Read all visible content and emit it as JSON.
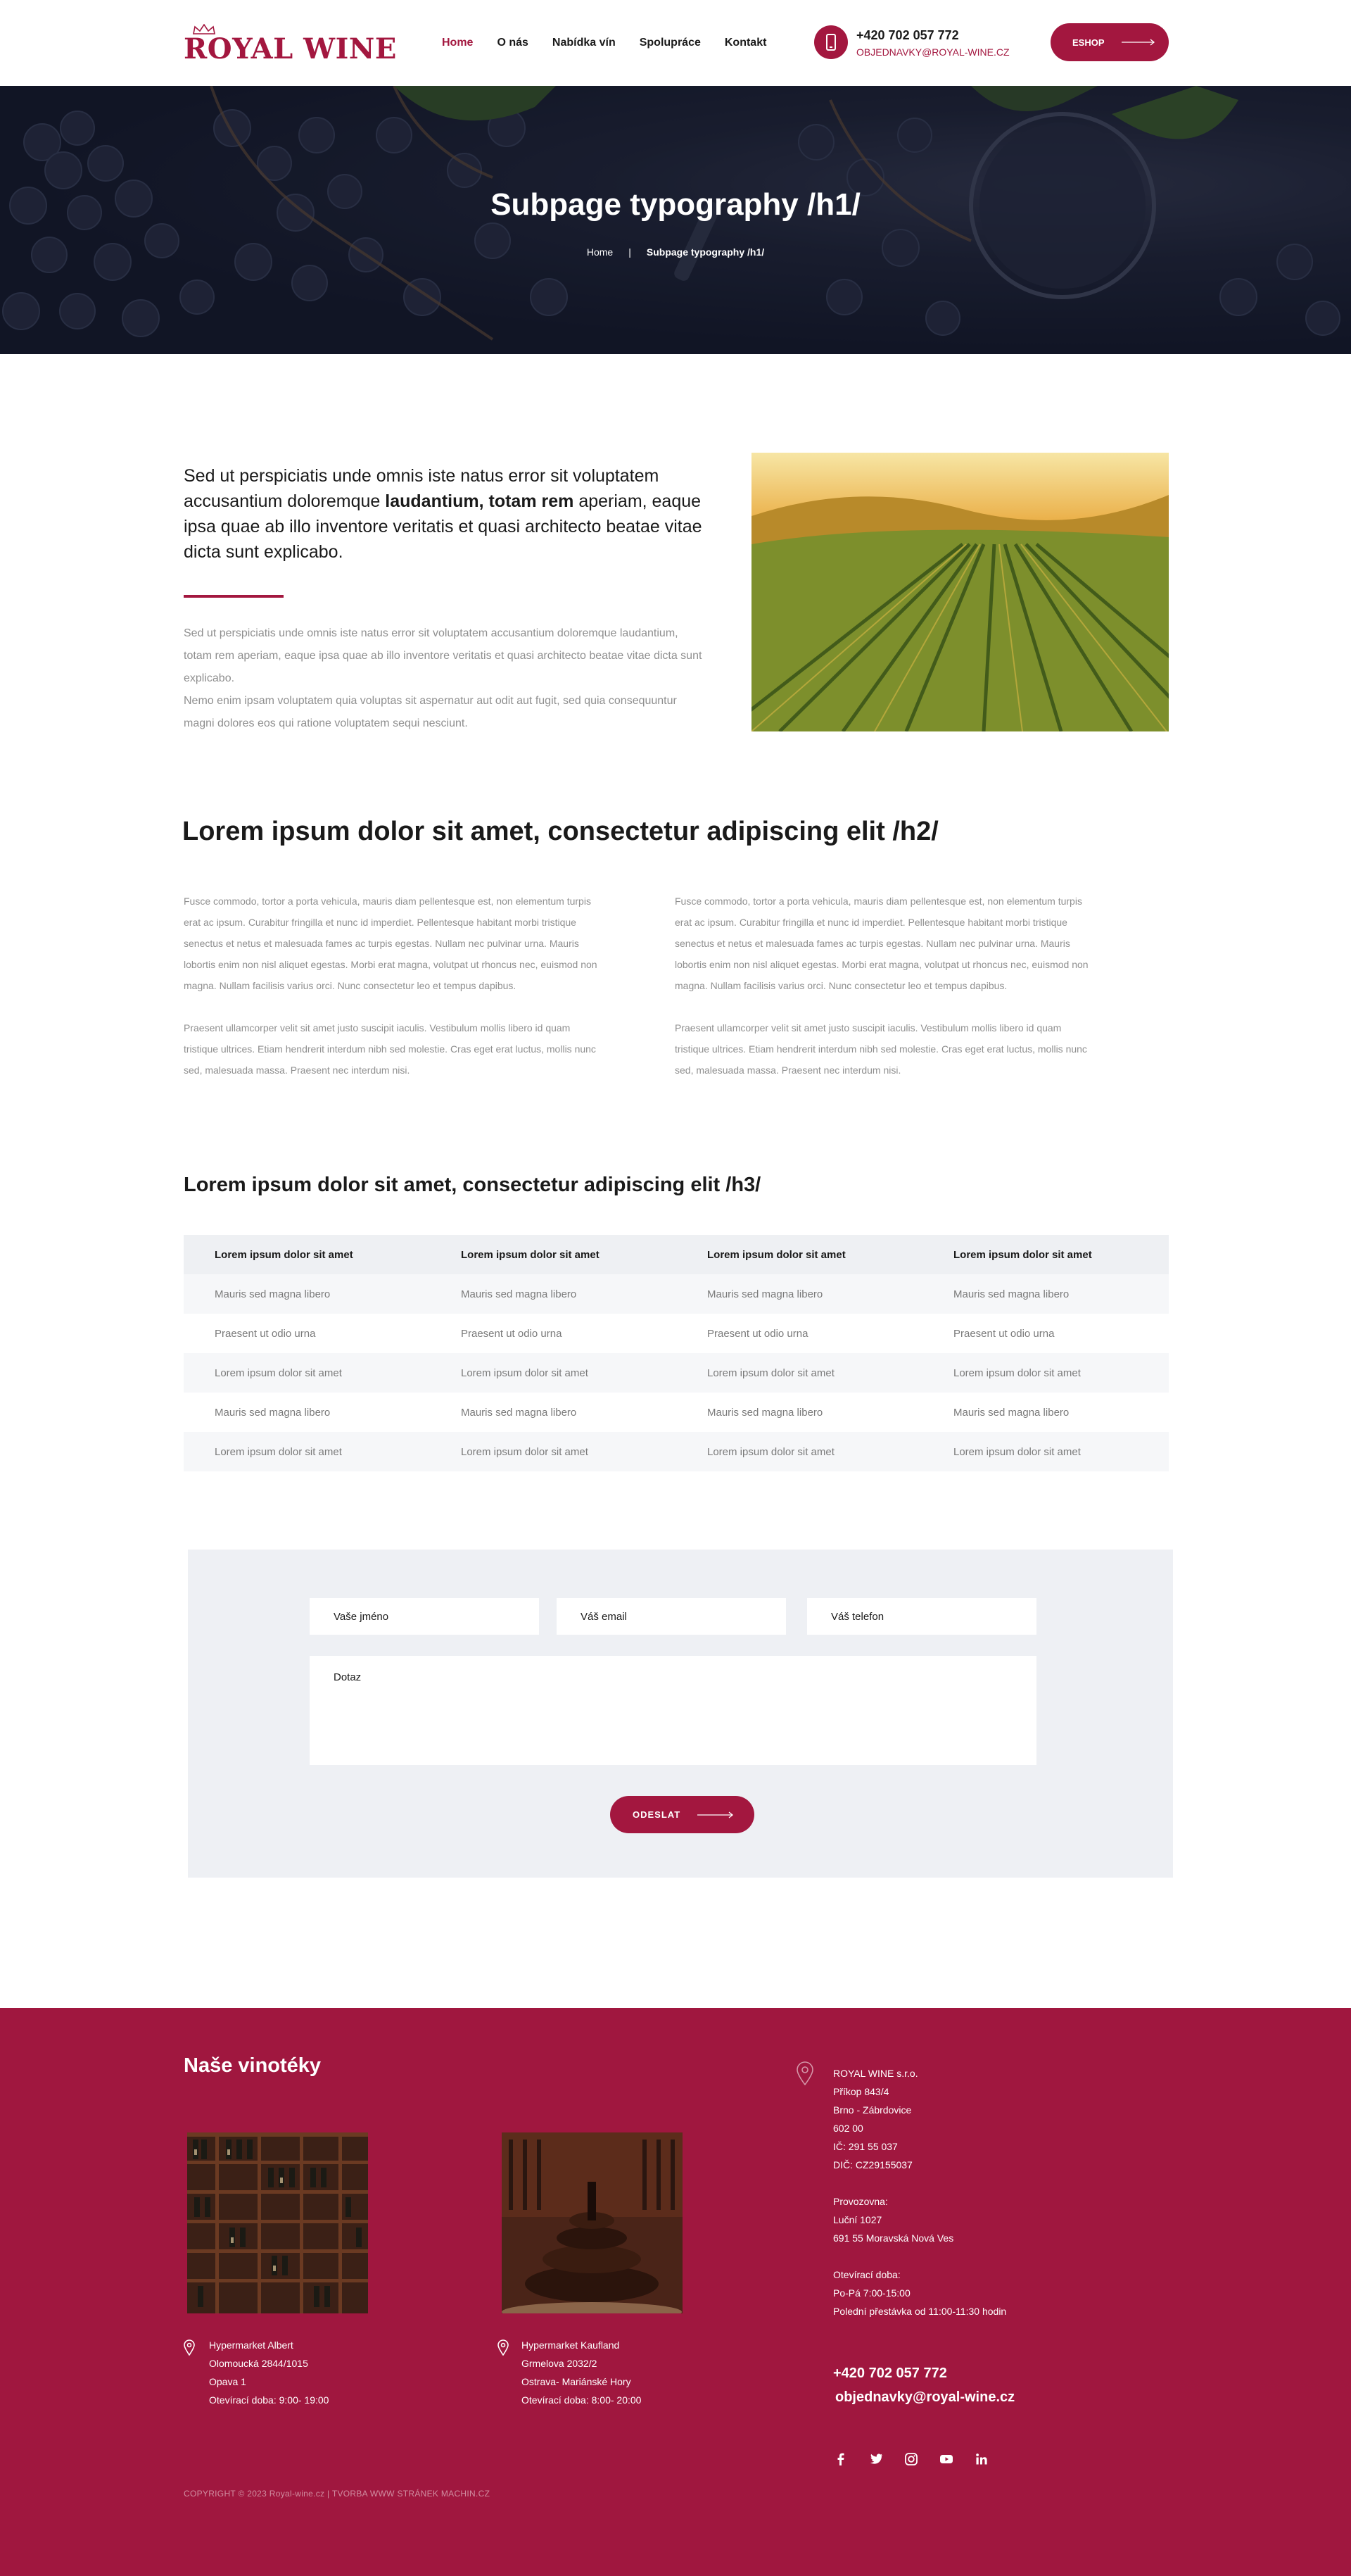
{
  "header": {
    "logo_text": "ROYAL WINE",
    "nav": [
      "Home",
      "O nás",
      "Nabídka vín",
      "Spolupráce",
      "Kontakt"
    ],
    "phone": "+420 702 057 772",
    "email": "OBJEDNAVKY@ROYAL-WINE.CZ",
    "eshop_label": "ESHOP"
  },
  "hero": {
    "title": "Subpage typography /h1/",
    "breadcrumb_home": "Home",
    "breadcrumb_current": "Subpage typography /h1/"
  },
  "intro": {
    "lead_1": "Sed ut perspiciatis unde omnis iste natus error sit voluptatem accusantium doloremque ",
    "lead_bold": "laudantium, totam rem",
    "lead_2": " aperiam, eaque ipsa quae ab illo inventore veritatis et quasi architecto beatae vitae dicta sunt explicabo.",
    "paragraph": "Sed ut perspiciatis unde omnis iste natus error sit voluptatem accusantium doloremque laudantium, totam rem aperiam, eaque ipsa quae ab illo inventore veritatis et quasi architecto beatae vitae dicta sunt explicabo.",
    "paragraph_2": "Nemo enim ipsam voluptatem quia voluptas sit aspernatur aut odit aut fugit, sed quia consequuntur magni dolores eos qui ratione voluptatem sequi nesciunt."
  },
  "section_h2": {
    "title": "Lorem ipsum dolor sit amet, consectetur adipiscing elit /h2/",
    "p1": "Fusce commodo, tortor a porta vehicula, mauris diam pellentesque est, non elementum turpis erat ac ipsum. Curabitur fringilla et nunc id imperdiet. Pellentesque habitant morbi tristique senectus et netus et malesuada fames ac turpis egestas. Nullam nec pulvinar urna. Mauris lobortis enim non nisl aliquet egestas. Morbi erat magna, volutpat ut rhoncus nec, euismod non magna. Nullam facilisis varius orci. Nunc consectetur leo et tempus dapibus.",
    "p2": "Praesent ullamcorper velit sit amet justo suscipit iaculis. Vestibulum mollis libero id quam tristique ultrices. Etiam hendrerit interdum nibh sed molestie. Cras eget erat luctus, mollis nunc sed, malesuada massa. Praesent nec interdum nisi."
  },
  "section_h3": {
    "title": "Lorem ipsum dolor sit amet, consectetur adipiscing elit /h3/"
  },
  "table": {
    "headers": [
      "Lorem ipsum dolor sit amet",
      "Lorem ipsum dolor sit amet",
      "Lorem ipsum dolor sit amet",
      "Lorem ipsum dolor sit amet"
    ],
    "rows": [
      [
        "Mauris sed magna libero",
        "Mauris sed magna libero",
        "Mauris sed magna libero",
        "Mauris sed magna libero"
      ],
      [
        "Praesent ut odio urna",
        "Praesent ut odio urna",
        "Praesent ut odio urna",
        "Praesent ut odio urna"
      ],
      [
        "Lorem ipsum dolor sit amet",
        "Lorem ipsum dolor sit amet",
        "Lorem ipsum dolor sit amet",
        "Lorem ipsum dolor sit amet"
      ],
      [
        "Mauris sed magna libero",
        "Mauris sed magna libero",
        "Mauris sed magna libero",
        "Mauris sed magna libero"
      ],
      [
        "Lorem ipsum dolor sit amet",
        "Lorem ipsum dolor sit amet",
        "Lorem ipsum dolor sit amet",
        "Lorem ipsum dolor sit amet"
      ]
    ]
  },
  "form": {
    "name_placeholder": "Vaše jméno",
    "email_placeholder": "Váš email",
    "phone_placeholder": "Váš telefon",
    "question_placeholder": "Dotaz",
    "submit_label": "ODESLAT"
  },
  "footer": {
    "title": "Naše vinotéky",
    "shop_1": [
      "Hypermarket Albert",
      "Olomoucká 2844/1015",
      "Opava 1",
      "Otevírací doba: 9:00- 19:00"
    ],
    "shop_2": [
      "Hypermarket Kaufland",
      "Grmelova 2032/2",
      "Ostrava- Mariánské Hory",
      "Otevírací doba: 8:00- 20:00"
    ],
    "company": [
      "ROYAL WINE s.r.o.",
      "Příkop 843/4",
      "Brno - Zábrdovice",
      "602 00",
      "IČ: 291 55 037",
      "DIČ: CZ29155037"
    ],
    "branch": [
      "Provozovna:",
      "Luční 1027",
      "691 55 Moravská Nová Ves"
    ],
    "hours": [
      "Otevírací doba:",
      "Po-Pá 7:00-15:00",
      "Polední přestávka od 11:00-11:30 hodin"
    ],
    "phone": "+420 702 057 772",
    "email": "objednavky@royal-wine.cz",
    "copyright": "COPYRIGHT © 2023 Royal-wine.cz  |  TVORBA WWW STRÁNEK MACHIN.CZ"
  }
}
